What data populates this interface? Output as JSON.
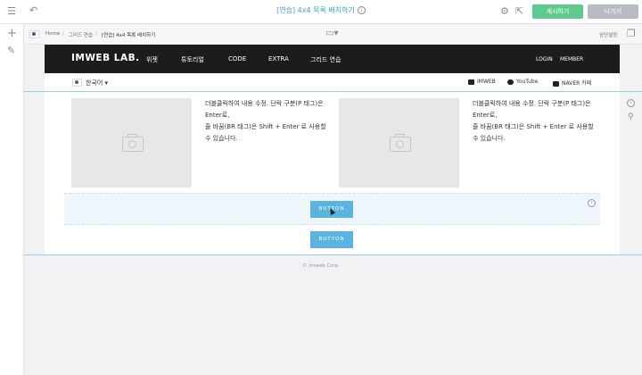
{
  "top": {
    "title": "[연습] 4x4 목록 배치하기",
    "publish_label": "게시하기",
    "exit_label": "나가기"
  },
  "icons": {
    "menu": "hamburger-icon",
    "undo": "undo-icon",
    "settings": "gear-icon",
    "external": "external-link-icon",
    "info": "info-icon",
    "add": "plus-icon",
    "tool": "wrench-icon",
    "device": "monitor-icon",
    "copy": "copy-icon",
    "pin": "pin-icon"
  },
  "subbar": {
    "breadcrumb": [
      "Home",
      "그리드 연습",
      "[연습] 4x4 목록 배치하기"
    ],
    "right_label": "상단설정"
  },
  "site": {
    "logo": "IMWEB LAB.",
    "menu": [
      "위젯",
      "튜토리얼",
      "CODE",
      "EXTRA",
      "그리드 연습"
    ],
    "right_menu": [
      "LOGIN",
      "MEMBER"
    ],
    "language": "한국어",
    "social": [
      "IMWEB",
      "YouTube",
      "NAVER 카페"
    ]
  },
  "content": {
    "paragraphs": [
      [
        "더블클릭하여 내용 수정. 단락 구분(P 태그)은 Enter로,",
        "줄 바꿈(BR 태그)은 Shift + Enter 로 사용할 수 있습니다."
      ],
      [
        "더블클릭하여 내용 수정. 단락 구분(P 태그)은 Enter로,",
        "줄 바꿈(BR 태그)은 Shift + Enter 로 사용할 수 있습니다."
      ]
    ],
    "button_label": "BUTTON",
    "footer": "© Imweb Corp."
  },
  "colors": {
    "accent": "#3aa0d8",
    "publish": "#5dcb8f",
    "exit": "#b7bcc4",
    "site_button": "#5ab4e0",
    "nav_bg": "#1c1c1e"
  }
}
